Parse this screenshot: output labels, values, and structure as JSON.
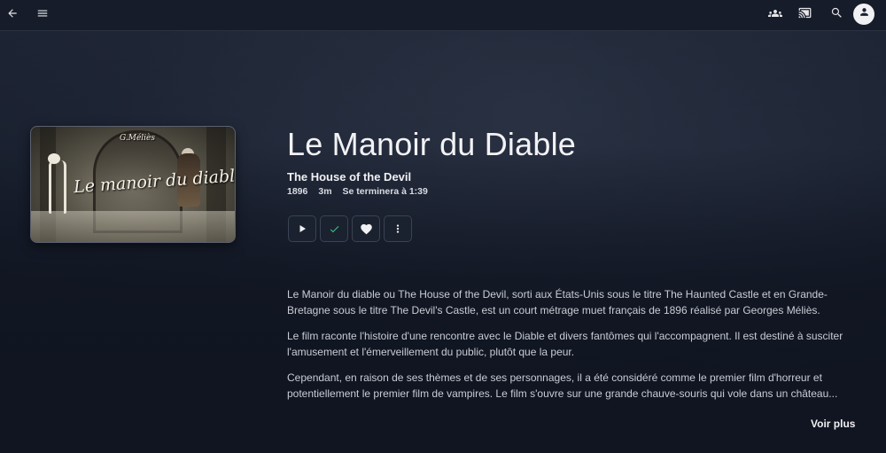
{
  "topbar": {
    "back_icon": "arrow-left-icon",
    "menu_icon": "hamburger-menu-icon",
    "users_icon": "group-icon",
    "cast_icon": "cast-icon",
    "search_icon": "search-icon",
    "user_icon": "user-icon"
  },
  "poster": {
    "title_art": "Le manoir du diable",
    "signature": "G.Méliès"
  },
  "movie": {
    "title": "Le Manoir du Diable",
    "original_title": "The House of the Devil",
    "year": "1896",
    "runtime": "3m",
    "ends_at": "Se terminera à 1:39"
  },
  "actions": {
    "play_icon": "play-icon",
    "watched_icon": "check-icon",
    "favorite_icon": "heart-icon",
    "more_icon": "more-vertical-icon",
    "watched_color": "#3fbf7f"
  },
  "overview": {
    "paragraphs": [
      "Le Manoir du diable ou The House of the Devil, sorti aux États-Unis sous le titre The Haunted Castle et en Grande-Bretagne sous le titre The Devil's Castle, est un court métrage muet français de 1896 réalisé par Georges Méliès.",
      "Le film raconte l'histoire d'une rencontre avec le Diable et divers fantômes qui l'accompagnent. Il est destiné à susciter l'amusement et l'émerveillement du public, plutôt que la peur.",
      "Cependant, en raison de ses thèmes et de ses personnages, il a été considéré comme le premier film d'horreur et potentiellement le premier film de vampires. Le film s'ouvre sur une grande chauve-souris qui vole dans un château..."
    ],
    "more_label": "Voir plus"
  }
}
